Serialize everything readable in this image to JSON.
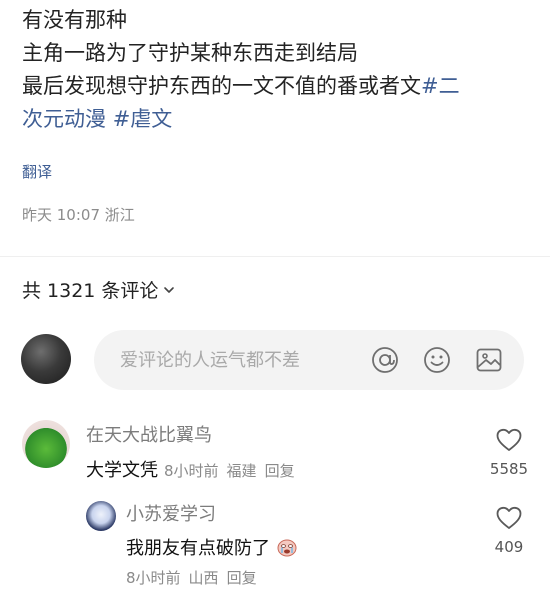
{
  "post": {
    "line1": "有没有那种",
    "line2": "主角一路为了守护某种东西走到结局",
    "line3": "最后发现想守护东西的一文不值的番或者文",
    "hashtag1": "#二",
    "line4_hashtag1_cont": "次元动漫",
    "hashtag2": "#虐文"
  },
  "translate_label": "翻译",
  "meta": "昨天 10:07 浙江",
  "comments_header": {
    "label": "共 1321 条评论"
  },
  "input": {
    "placeholder": "爱评论的人运气都不差"
  },
  "icons": {
    "mention": "at-icon",
    "emoji": "smiley-icon",
    "image": "image-icon",
    "like": "heart-icon",
    "chevron": "chevron-down-icon"
  },
  "comments": [
    {
      "user": "在天大战比翼鸟",
      "text": "大学文凭",
      "time": "8小时前",
      "location": "福建",
      "reply": "回复",
      "likes": "5585",
      "replies": [
        {
          "user": "小苏爱学习",
          "text": "我朋友有点破防了",
          "time": "8小时前",
          "location": "山西",
          "reply": "回复",
          "likes": "409"
        }
      ]
    }
  ],
  "colors": {
    "link": "#3f5e94",
    "muted": "#8c8c8c",
    "input_bg": "#f3f3f3"
  }
}
